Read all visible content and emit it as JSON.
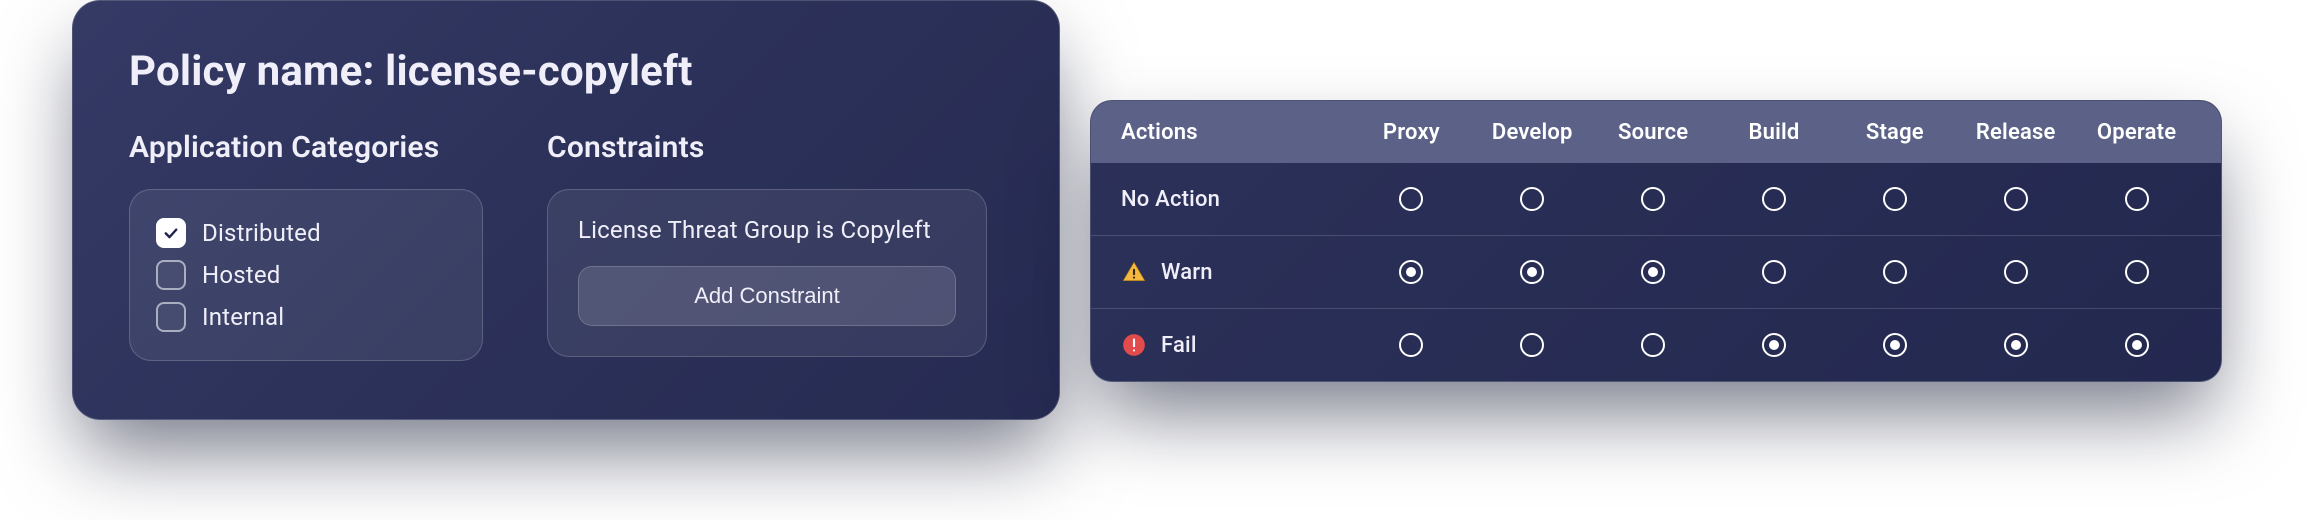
{
  "policy": {
    "title": "Policy name: license-copyleft",
    "categories": {
      "heading": "Application Categories",
      "items": [
        {
          "label": "Distributed",
          "checked": true
        },
        {
          "label": "Hosted",
          "checked": false
        },
        {
          "label": "Internal",
          "checked": false
        }
      ]
    },
    "constraints": {
      "heading": "Constraints",
      "text": "License Threat Group is Copyleft",
      "add_label": "Add Constraint"
    }
  },
  "actions_table": {
    "columns": [
      "Actions",
      "Proxy",
      "Develop",
      "Source",
      "Build",
      "Stage",
      "Release",
      "Operate"
    ],
    "rows": [
      {
        "icon": "none",
        "label": "No Action",
        "selected": [
          false,
          false,
          false,
          false,
          false,
          false,
          false
        ]
      },
      {
        "icon": "warn",
        "label": "Warn",
        "selected": [
          true,
          true,
          true,
          false,
          false,
          false,
          false
        ]
      },
      {
        "icon": "fail",
        "label": "Fail",
        "selected": [
          false,
          false,
          false,
          true,
          true,
          true,
          true
        ]
      }
    ]
  }
}
